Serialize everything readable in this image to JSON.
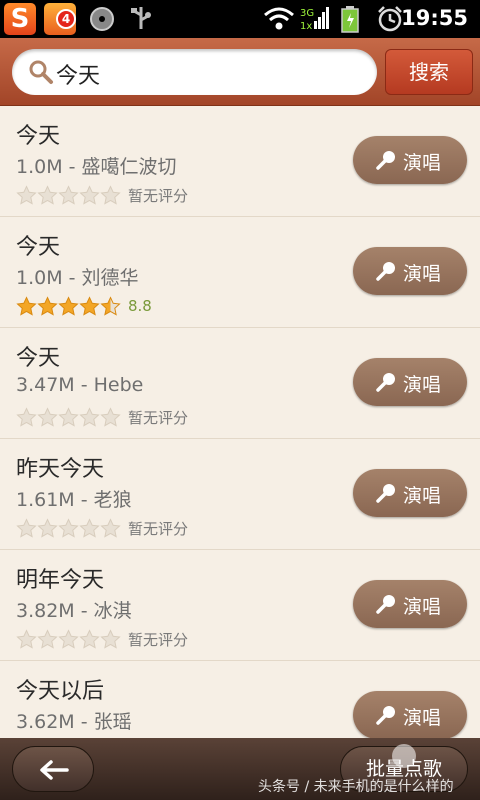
{
  "status_bar": {
    "time": "19:55",
    "notification_badge": "4",
    "sogou_letter": "S",
    "icons": [
      "sogou-icon",
      "fruit-app-icon",
      "cd-icon",
      "usb-icon",
      "wifi-icon",
      "3g-signal-icon",
      "battery-icon",
      "alarm-icon"
    ]
  },
  "search": {
    "query": "今天",
    "button_label": "搜索"
  },
  "songs": [
    {
      "title": "今天",
      "meta": "1.0M - 盛噶仁波切",
      "stars": 0,
      "rating": "暂无评分",
      "action": "演唱"
    },
    {
      "title": "今天",
      "meta": "1.0M - 刘德华",
      "stars": 4.5,
      "rating": "8.8",
      "action": "演唱"
    },
    {
      "title": "今天",
      "meta": "3.47M - Hebe",
      "stars": 0,
      "rating": "暂无评分",
      "action": "演唱"
    },
    {
      "title": "昨天今天",
      "meta": "1.61M - 老狼",
      "stars": 0,
      "rating": "暂无评分",
      "action": "演唱"
    },
    {
      "title": "明年今天",
      "meta": "3.82M - 冰淇",
      "stars": 0,
      "rating": "暂无评分",
      "action": "演唱"
    },
    {
      "title": "今天以后",
      "meta": "3.62M - 张瑶",
      "stars": 0,
      "rating": "",
      "action": "演唱"
    }
  ],
  "bottom_bar": {
    "batch_label": "批量点歌",
    "watermark": "头条号 / 未来手机的是什么样的"
  },
  "colors": {
    "header": "#b5502f",
    "sing_button": "#977460",
    "star_filled": "#f3a626",
    "star_empty": "#e8e0d4",
    "rating_number": "#7a9a3a"
  }
}
